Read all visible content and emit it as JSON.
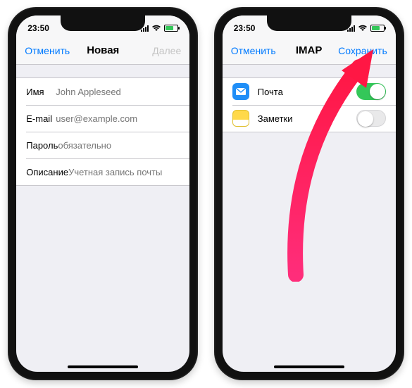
{
  "status": {
    "time": "23:50"
  },
  "left": {
    "nav": {
      "cancel": "Отменить",
      "title": "Новая",
      "next": "Далее"
    },
    "fields": {
      "name": {
        "label": "Имя",
        "placeholder": "John Appleseed"
      },
      "email": {
        "label": "E-mail",
        "placeholder": "user@example.com"
      },
      "password": {
        "label": "Пароль",
        "placeholder": "обязательно"
      },
      "description": {
        "label": "Описание",
        "placeholder": "Учетная запись почты"
      }
    }
  },
  "right": {
    "nav": {
      "cancel": "Отменить",
      "title": "IMAP",
      "save": "Сохранить"
    },
    "items": {
      "mail": {
        "label": "Почта",
        "icon": "mail-icon",
        "on": true
      },
      "notes": {
        "label": "Заметки",
        "icon": "notes-icon",
        "on": false
      }
    }
  }
}
